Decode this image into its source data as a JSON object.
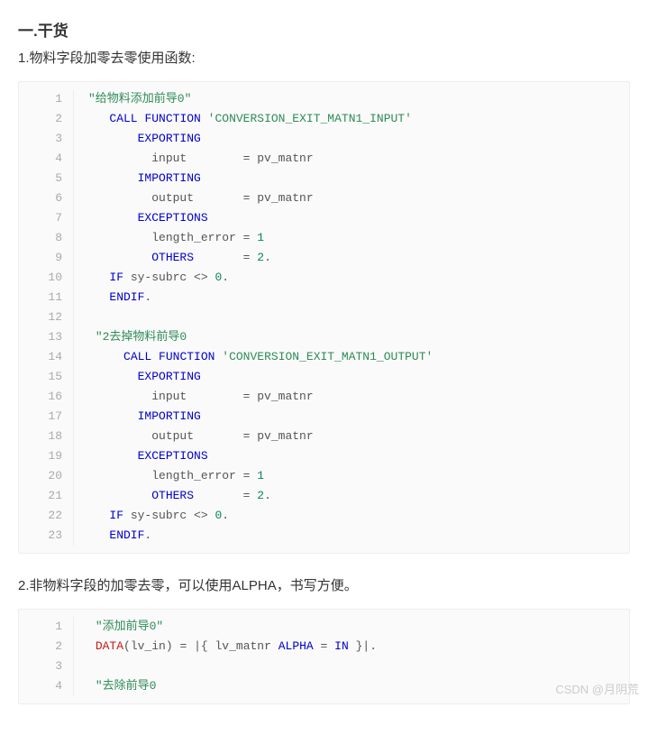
{
  "heading": "一.干货",
  "desc1": "1.物料字段加零去零使用函数:",
  "desc2": "2.非物料字段的加零去零，可以使用ALPHA，书写方便。",
  "watermark": "CSDN @月阴荒",
  "code1": [
    [
      {
        "t": "string",
        "v": "\"给物料添加前导0\""
      }
    ],
    [
      {
        "t": "plain",
        "v": "   "
      },
      {
        "t": "keyword",
        "v": "CALL"
      },
      {
        "t": "plain",
        "v": " "
      },
      {
        "t": "keyword",
        "v": "FUNCTION"
      },
      {
        "t": "plain",
        "v": " "
      },
      {
        "t": "string",
        "v": "'CONVERSION_EXIT_MATN1_INPUT'"
      }
    ],
    [
      {
        "t": "plain",
        "v": "       "
      },
      {
        "t": "keyword",
        "v": "EXPORTING"
      }
    ],
    [
      {
        "t": "plain",
        "v": "         input        "
      },
      {
        "t": "op",
        "v": "="
      },
      {
        "t": "plain",
        "v": " pv_matnr"
      }
    ],
    [
      {
        "t": "plain",
        "v": "       "
      },
      {
        "t": "keyword",
        "v": "IMPORTING"
      }
    ],
    [
      {
        "t": "plain",
        "v": "         output       "
      },
      {
        "t": "op",
        "v": "="
      },
      {
        "t": "plain",
        "v": " pv_matnr"
      }
    ],
    [
      {
        "t": "plain",
        "v": "       "
      },
      {
        "t": "keyword",
        "v": "EXCEPTIONS"
      }
    ],
    [
      {
        "t": "plain",
        "v": "         length_error "
      },
      {
        "t": "op",
        "v": "="
      },
      {
        "t": "plain",
        "v": " "
      },
      {
        "t": "num",
        "v": "1"
      }
    ],
    [
      {
        "t": "plain",
        "v": "         "
      },
      {
        "t": "keyword",
        "v": "OTHERS"
      },
      {
        "t": "plain",
        "v": "       "
      },
      {
        "t": "op",
        "v": "="
      },
      {
        "t": "plain",
        "v": " "
      },
      {
        "t": "num",
        "v": "2"
      },
      {
        "t": "plain",
        "v": "."
      }
    ],
    [
      {
        "t": "plain",
        "v": "   "
      },
      {
        "t": "keyword",
        "v": "IF"
      },
      {
        "t": "plain",
        "v": " sy-subrc "
      },
      {
        "t": "op",
        "v": "<>"
      },
      {
        "t": "plain",
        "v": " "
      },
      {
        "t": "num",
        "v": "0"
      },
      {
        "t": "plain",
        "v": "."
      }
    ],
    [
      {
        "t": "plain",
        "v": "   "
      },
      {
        "t": "keyword",
        "v": "ENDIF"
      },
      {
        "t": "plain",
        "v": "."
      }
    ],
    [
      {
        "t": "plain",
        "v": ""
      }
    ],
    [
      {
        "t": "plain",
        "v": " "
      },
      {
        "t": "string",
        "v": "\"2去掉物料前导0"
      }
    ],
    [
      {
        "t": "plain",
        "v": "     "
      },
      {
        "t": "keyword",
        "v": "CALL"
      },
      {
        "t": "plain",
        "v": " "
      },
      {
        "t": "keyword",
        "v": "FUNCTION"
      },
      {
        "t": "plain",
        "v": " "
      },
      {
        "t": "string",
        "v": "'CONVERSION_EXIT_MATN1_OUTPUT'"
      }
    ],
    [
      {
        "t": "plain",
        "v": "       "
      },
      {
        "t": "keyword",
        "v": "EXPORTING"
      }
    ],
    [
      {
        "t": "plain",
        "v": "         input        "
      },
      {
        "t": "op",
        "v": "="
      },
      {
        "t": "plain",
        "v": " pv_matnr"
      }
    ],
    [
      {
        "t": "plain",
        "v": "       "
      },
      {
        "t": "keyword",
        "v": "IMPORTING"
      }
    ],
    [
      {
        "t": "plain",
        "v": "         output       "
      },
      {
        "t": "op",
        "v": "="
      },
      {
        "t": "plain",
        "v": " pv_matnr"
      }
    ],
    [
      {
        "t": "plain",
        "v": "       "
      },
      {
        "t": "keyword",
        "v": "EXCEPTIONS"
      }
    ],
    [
      {
        "t": "plain",
        "v": "         length_error "
      },
      {
        "t": "op",
        "v": "="
      },
      {
        "t": "plain",
        "v": " "
      },
      {
        "t": "num",
        "v": "1"
      }
    ],
    [
      {
        "t": "plain",
        "v": "         "
      },
      {
        "t": "keyword",
        "v": "OTHERS"
      },
      {
        "t": "plain",
        "v": "       "
      },
      {
        "t": "op",
        "v": "="
      },
      {
        "t": "plain",
        "v": " "
      },
      {
        "t": "num",
        "v": "2"
      },
      {
        "t": "plain",
        "v": "."
      }
    ],
    [
      {
        "t": "plain",
        "v": "   "
      },
      {
        "t": "keyword",
        "v": "IF"
      },
      {
        "t": "plain",
        "v": " sy-subrc "
      },
      {
        "t": "op",
        "v": "<>"
      },
      {
        "t": "plain",
        "v": " "
      },
      {
        "t": "num",
        "v": "0"
      },
      {
        "t": "plain",
        "v": "."
      }
    ],
    [
      {
        "t": "plain",
        "v": "   "
      },
      {
        "t": "keyword",
        "v": "ENDIF"
      },
      {
        "t": "plain",
        "v": "."
      }
    ]
  ],
  "code2": [
    [
      {
        "t": "plain",
        "v": " "
      },
      {
        "t": "string",
        "v": "\"添加前导0\""
      }
    ],
    [
      {
        "t": "plain",
        "v": " "
      },
      {
        "t": "data",
        "v": "DATA"
      },
      {
        "t": "plain",
        "v": "(lv_in) "
      },
      {
        "t": "op",
        "v": "="
      },
      {
        "t": "plain",
        "v": " "
      },
      {
        "t": "op",
        "v": "|"
      },
      {
        "t": "plain",
        "v": "{ lv_matnr "
      },
      {
        "t": "keyword",
        "v": "ALPHA"
      },
      {
        "t": "plain",
        "v": " "
      },
      {
        "t": "op",
        "v": "="
      },
      {
        "t": "plain",
        "v": " "
      },
      {
        "t": "keyword",
        "v": "IN"
      },
      {
        "t": "plain",
        "v": " }"
      },
      {
        "t": "op",
        "v": "|"
      },
      {
        "t": "plain",
        "v": "."
      }
    ],
    [
      {
        "t": "plain",
        "v": ""
      }
    ],
    [
      {
        "t": "plain",
        "v": " "
      },
      {
        "t": "string",
        "v": "\"去除前导0"
      }
    ]
  ]
}
